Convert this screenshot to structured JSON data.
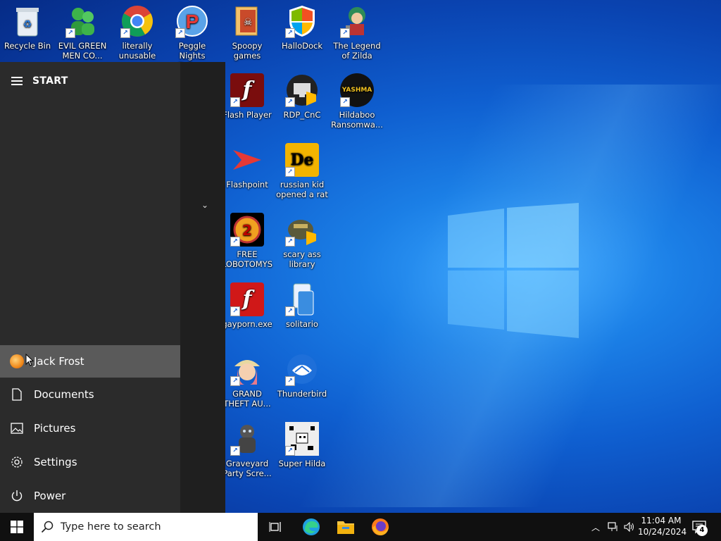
{
  "desktop": {
    "icons": [
      {
        "label": "Recycle Bin",
        "icon": "recycle-bin-icon"
      },
      {
        "label": "EVIL GREEN MEN CO...",
        "icon": "green-men-icon"
      },
      {
        "label": "literally unusable",
        "icon": "chrome-icon"
      },
      {
        "label": "Peggle Nights Deluxe",
        "icon": "peggle-icon"
      },
      {
        "label": "Spoopy games",
        "icon": "folder-icon"
      },
      {
        "label": "HalloDock",
        "icon": "shield-icon"
      },
      {
        "label": "The Legend of Zilda",
        "icon": "zilda-icon"
      },
      {
        "label": "Flash Player",
        "icon": "flash-icon"
      },
      {
        "label": "RDP_CnC",
        "icon": "rdp-icon"
      },
      {
        "label": "Hildaboo Ransomwa...",
        "icon": "yashma-icon",
        "badge_text": "YASHMA"
      },
      {
        "label": "Flashpoint",
        "icon": "flashpoint-icon"
      },
      {
        "label": "russian kid opened a rat",
        "icon": "de-icon",
        "badge_text": "De"
      },
      {
        "label": "FREE LOBOTOMYS",
        "icon": "lobotomy-icon"
      },
      {
        "label": "scary ass library",
        "icon": "library-icon"
      },
      {
        "label": "gayporn.exe",
        "icon": "flash-icon"
      },
      {
        "label": "solitario",
        "icon": "solitaire-icon"
      },
      {
        "label": "GRAND THEFT AU...",
        "icon": "gta-icon"
      },
      {
        "label": "Thunderbird",
        "icon": "thunderbird-icon"
      },
      {
        "label": "Graveyard Party Scre...",
        "icon": "graveyard-icon"
      },
      {
        "label": "Super Hilda",
        "icon": "super-hilda-icon"
      }
    ]
  },
  "start_menu": {
    "title": "START",
    "user": {
      "label": "Jack Frost",
      "icon": "avatar-icon"
    },
    "items": [
      {
        "label": "Documents",
        "icon": "document-icon"
      },
      {
        "label": "Pictures",
        "icon": "pictures-icon"
      },
      {
        "label": "Settings",
        "icon": "gear-icon"
      },
      {
        "label": "Power",
        "icon": "power-icon"
      }
    ]
  },
  "taskbar": {
    "search_placeholder": "Type here to search",
    "apps": [
      "task-view-icon",
      "edge-icon",
      "file-explorer-icon",
      "firefox-icon"
    ],
    "clock_time": "11:04 AM",
    "clock_date": "10/24/2024",
    "notification_count": "4"
  },
  "colors": {
    "desktop_blue": "#0f5fd0",
    "start_bg": "#1f1f1f",
    "taskbar_bg": "#101010",
    "active_item": "#5a5a5a"
  }
}
